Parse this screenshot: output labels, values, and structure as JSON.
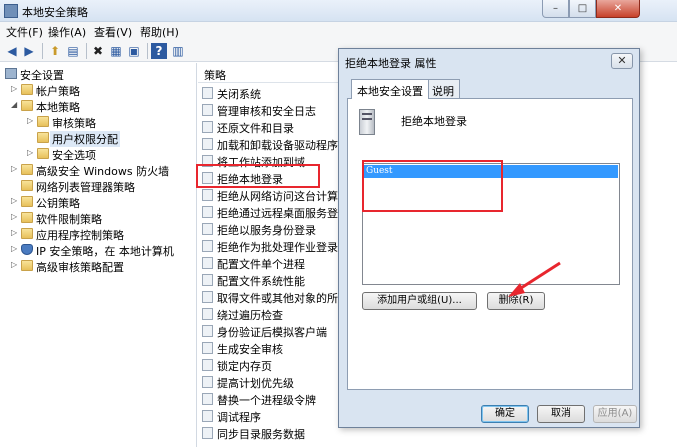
{
  "window": {
    "title": "本地安全策略"
  },
  "menu": {
    "file": "文件(F)",
    "action": "操作(A)",
    "view": "查看(V)",
    "help": "帮助(H)"
  },
  "toolbar": {
    "back": "◀",
    "forward": "▶",
    "up": "⬆",
    "showhide": "▤",
    "delete": "✖",
    "properties": "▦",
    "export": "▣",
    "help": "?",
    "view": "▥"
  },
  "tree": {
    "root": "安全设置",
    "account_policy": "帐户策略",
    "local_policy": "本地策略",
    "audit_policy": "审核策略",
    "user_rights": "用户权限分配",
    "security_options": "安全选项",
    "firewall": "高级安全 Windows 防火墙",
    "network_list": "网络列表管理器策略",
    "public_key": "公钥策略",
    "software_restriction": "软件限制策略",
    "app_control": "应用程序控制策略",
    "ipsec": "IP 安全策略，在 本地计算机",
    "audit_config": "高级审核策略配置"
  },
  "policy": {
    "header": "策略",
    "items": [
      "关闭系统",
      "管理审核和安全日志",
      "还原文件和目录",
      "加载和卸载设备驱动程序",
      "将工作站添加到域",
      "拒绝本地登录",
      "拒绝从网络访问这台计算机",
      "拒绝通过远程桌面服务登录",
      "拒绝以服务身份登录",
      "拒绝作为批处理作业登录",
      "配置文件单个进程",
      "配置文件系统性能",
      "取得文件或其他对象的所有权",
      "绕过遍历检查",
      "身份验证后模拟客户端",
      "生成安全审核",
      "锁定内存页",
      "提高计划优先级",
      "替换一个进程级令牌",
      "调试程序",
      "同步目录服务数据"
    ]
  },
  "dialog": {
    "title": "拒绝本地登录 属性",
    "close": "✕",
    "tab_local": "本地安全设置",
    "tab_explain": "说明",
    "panel_title": "拒绝本地登录",
    "list_items": [
      "Guest"
    ],
    "add_button": "添加用户或组(U)...",
    "remove_button": "删除(R)",
    "ok": "确定",
    "cancel": "取消",
    "apply": "应用(A)"
  },
  "colors": {
    "annotation": "#e8262e",
    "selection": "#3399ff"
  }
}
